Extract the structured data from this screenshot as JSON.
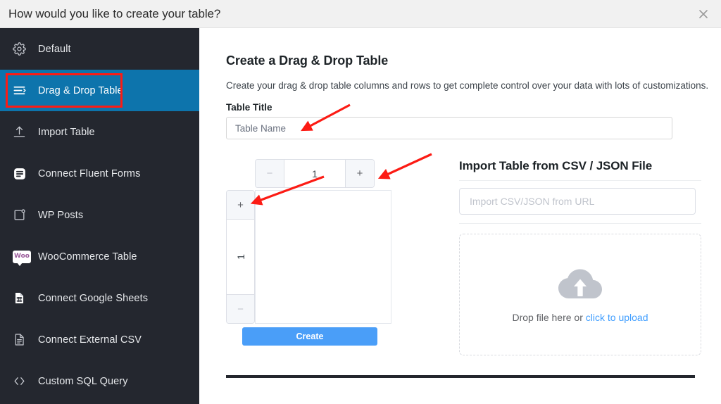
{
  "modal": {
    "title": "How would you like to create your table?",
    "close_icon": "close-icon"
  },
  "sidebar": {
    "items": [
      {
        "label": "Default",
        "icon": "gear-icon",
        "active": false
      },
      {
        "label": "Drag & Drop Table",
        "icon": "drag-drop-icon",
        "active": true
      },
      {
        "label": "Import Table",
        "icon": "upload-arrow-icon",
        "active": false
      },
      {
        "label": "Connect Fluent Forms",
        "icon": "fluent-forms-icon",
        "active": false
      },
      {
        "label": "WP Posts",
        "icon": "wp-posts-icon",
        "active": false
      },
      {
        "label": "WooCommerce Table",
        "icon": "woocommerce-icon",
        "active": false
      },
      {
        "label": "Connect Google Sheets",
        "icon": "google-sheets-icon",
        "active": false
      },
      {
        "label": "Connect External CSV",
        "icon": "csv-file-icon",
        "active": false
      },
      {
        "label": "Custom SQL Query",
        "icon": "code-brackets-icon",
        "active": false
      }
    ]
  },
  "main": {
    "heading": "Create a Drag & Drop Table",
    "description": "Create your drag & drop table columns and rows to get complete control over your data with lots of customizations.",
    "table_title_label": "Table Title",
    "table_title_value": "",
    "table_title_placeholder": "Table Name",
    "builder": {
      "columns_minus_label": "−",
      "columns_value": "1",
      "columns_plus_label": "+",
      "rows_plus_label": "+",
      "rows_value": "1",
      "rows_minus_label": "−",
      "create_label": "Create"
    }
  },
  "import": {
    "heading": "Import Table from CSV / JSON File",
    "url_value": "",
    "url_placeholder": "Import CSV/JSON from URL",
    "drop_text": "Drop file here or ",
    "drop_link": "click to upload",
    "cloud_icon": "cloud-upload-icon"
  },
  "annotations": {
    "highlight_target": "Drag & Drop Table",
    "arrow_1_target": "table-title-input",
    "arrow_2_target": "columns-plus-button",
    "arrow_3_target": "rows-plus-button",
    "color": "#fc1b14"
  },
  "colors": {
    "sidebar_bg": "#24272f",
    "active_item": "#0d74ac",
    "header_bg": "#f1f1f1",
    "primary_button": "#4a9ef8",
    "link": "#409eff",
    "annotation_red": "#fc1b14"
  }
}
